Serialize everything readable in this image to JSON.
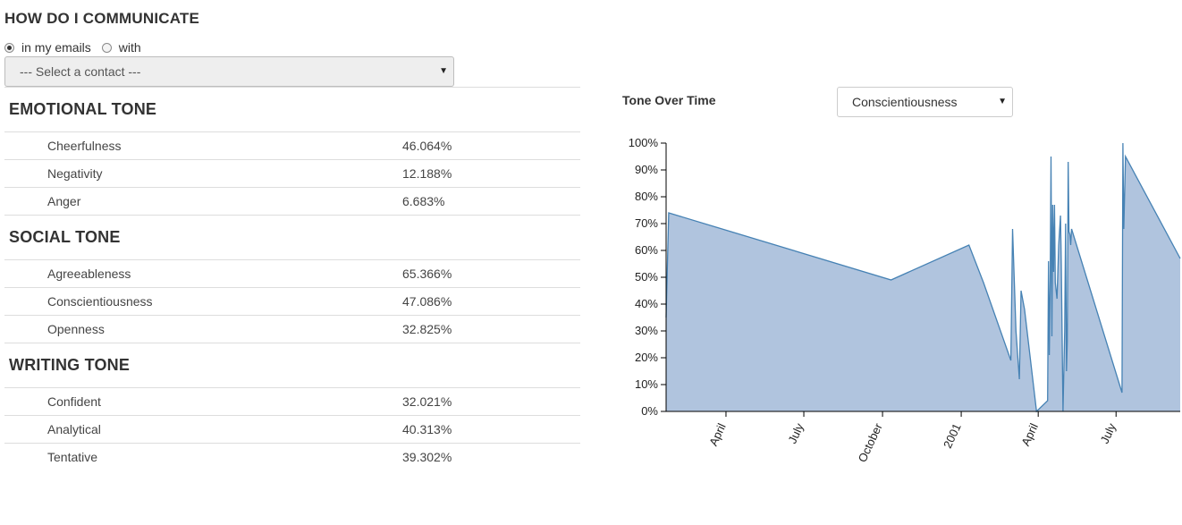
{
  "header": {
    "title": "HOW DO I COMMUNICATE"
  },
  "mode": {
    "options": [
      {
        "label": "in my emails",
        "checked": true
      },
      {
        "label": "with",
        "checked": false
      }
    ]
  },
  "contact_select": {
    "selected": "--- Select a contact ---"
  },
  "sections": [
    {
      "title": "EMOTIONAL TONE",
      "rows": [
        {
          "name": "Cheerfulness",
          "value": "46.064%"
        },
        {
          "name": "Negativity",
          "value": "12.188%"
        },
        {
          "name": "Anger",
          "value": "6.683%"
        }
      ]
    },
    {
      "title": "SOCIAL TONE",
      "rows": [
        {
          "name": "Agreeableness",
          "value": "65.366%"
        },
        {
          "name": "Conscientiousness",
          "value": "47.086%"
        },
        {
          "name": "Openness",
          "value": "32.825%"
        }
      ]
    },
    {
      "title": "WRITING TONE",
      "rows": [
        {
          "name": "Confident",
          "value": "32.021%"
        },
        {
          "name": "Analytical",
          "value": "40.313%"
        },
        {
          "name": "Tentative",
          "value": "39.302%"
        }
      ]
    }
  ],
  "tone_chart": {
    "title": "Tone Over Time",
    "selected_tone": "Conscientiousness"
  },
  "colors": {
    "area_fill": "#b0c4de",
    "area_line": "#4682b4",
    "divider": "#dddddd"
  },
  "chart_data": {
    "type": "area",
    "title": "",
    "xlabel": "",
    "ylabel": "",
    "ylim": [
      0,
      100
    ],
    "y_ticks": [
      "0%",
      "10%",
      "20%",
      "30%",
      "40%",
      "50%",
      "60%",
      "70%",
      "80%",
      "90%",
      "100%"
    ],
    "x_ticks": [
      {
        "date": "2000-04-01",
        "label": "April"
      },
      {
        "date": "2000-07-01",
        "label": "July"
      },
      {
        "date": "2000-10-01",
        "label": "October"
      },
      {
        "date": "2001-01-01",
        "label": "2001"
      },
      {
        "date": "2001-04-01",
        "label": "April"
      },
      {
        "date": "2001-07-01",
        "label": "July"
      }
    ],
    "xlim": [
      "2000-01-22",
      "2001-09-14"
    ],
    "series": [
      {
        "x": [
          "2000-01-22",
          "2000-01-25",
          "2000-10-11",
          "2001-01-10",
          "2001-01-27",
          "2001-02-28",
          "2001-03-02",
          "2001-03-06",
          "2001-03-10",
          "2001-03-12",
          "2001-03-16",
          "2001-03-30",
          "2001-04-12",
          "2001-04-13",
          "2001-04-14",
          "2001-04-15",
          "2001-04-16",
          "2001-04-17",
          "2001-04-18",
          "2001-04-19",
          "2001-04-20",
          "2001-04-21",
          "2001-04-23",
          "2001-04-25",
          "2001-04-27",
          "2001-04-28",
          "2001-04-30",
          "2001-05-02",
          "2001-05-03",
          "2001-05-04",
          "2001-05-05",
          "2001-05-06",
          "2001-05-07",
          "2001-05-08",
          "2001-05-09",
          "2001-05-10",
          "2001-07-08",
          "2001-07-09",
          "2001-07-10",
          "2001-07-12",
          "2001-09-14"
        ],
        "y": [
          35,
          74,
          49,
          62,
          48,
          19,
          68,
          30,
          12,
          45,
          38,
          0,
          4,
          56,
          21,
          49,
          95,
          28,
          77,
          52,
          77,
          48,
          42,
          62,
          73,
          55,
          0,
          30,
          70,
          15,
          26,
          93,
          67,
          66,
          62,
          68,
          7,
          100,
          68,
          95,
          57
        ]
      }
    ]
  }
}
